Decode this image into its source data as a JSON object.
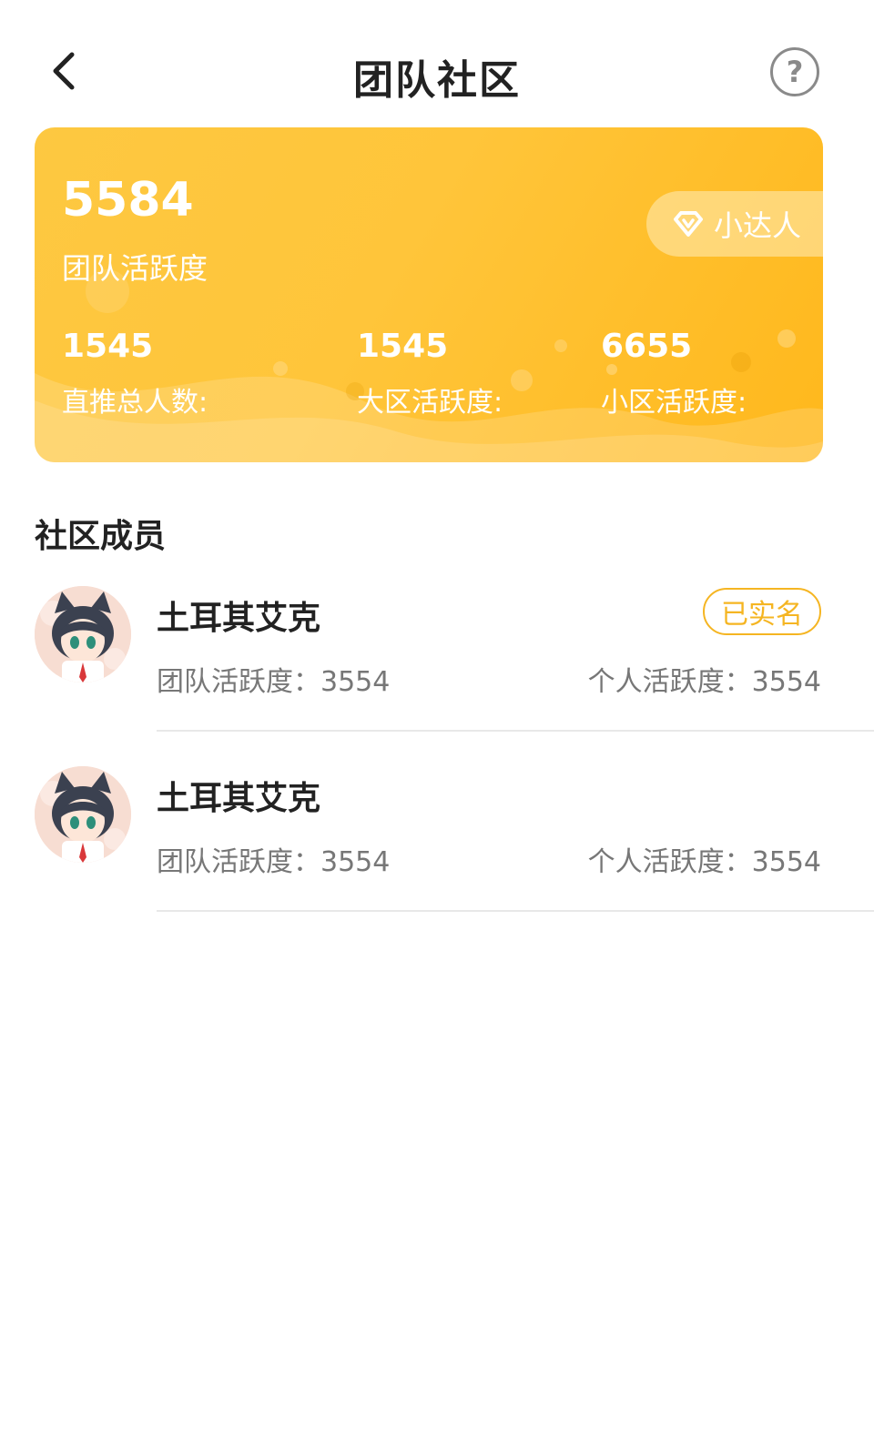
{
  "header": {
    "title": "团队社区",
    "back_icon": "chevron-left-icon",
    "help_icon": "question-circle-icon",
    "help_glyph": "?"
  },
  "stats_card": {
    "total_value": "5584",
    "total_label": "团队活跃度",
    "level_badge": {
      "icon": "diamond-icon",
      "label": "小达人"
    },
    "metrics": [
      {
        "value": "1545",
        "label": "直推总人数:"
      },
      {
        "value": "1545",
        "label": "大区活跃度:"
      },
      {
        "value": "6655",
        "label": "小区活跃度:"
      }
    ],
    "colors": {
      "card_start": "#fdc841",
      "card_end": "#ffb81c"
    }
  },
  "section": {
    "title": "社区成员"
  },
  "members": [
    {
      "name": "土耳其艾克",
      "verified_label": "已实名",
      "team_activity": "团队活跃度：3554",
      "personal_activity": "个人活跃度：3554"
    },
    {
      "name": "土耳其艾克",
      "verified_label": "",
      "team_activity": "团队活跃度：3554",
      "personal_activity": "个人活跃度：3554"
    }
  ],
  "colors": {
    "accent": "#f5b522",
    "text_primary": "#222222",
    "text_secondary": "#777777"
  }
}
